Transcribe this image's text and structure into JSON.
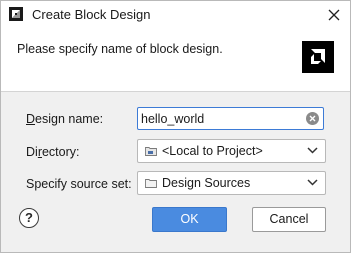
{
  "window": {
    "title": "Create Block Design",
    "close_icon": "close-icon",
    "app_icon": "block-design-icon"
  },
  "header": {
    "message": "Please specify name of block design.",
    "logo": "brand-logo"
  },
  "form": {
    "design_name": {
      "label_mnemonic": "D",
      "label_rest": "esign name:",
      "value": "hello_world",
      "clear_icon": "clear-circle-icon"
    },
    "directory": {
      "label_pre": "Di",
      "label_mnemonic": "r",
      "label_rest": "ectory:",
      "value": "<Local to Project>",
      "icon": "folder-local-icon"
    },
    "source_set": {
      "label": "Specify source set:",
      "value": "Design Sources",
      "icon": "folder-icon"
    }
  },
  "footer": {
    "help_label": "?",
    "ok_label": "OK",
    "cancel_label": "Cancel"
  },
  "colors": {
    "accent": "#4a8be0",
    "focus_border": "#3d7bd6",
    "panel_bg": "#f0f0f0"
  }
}
